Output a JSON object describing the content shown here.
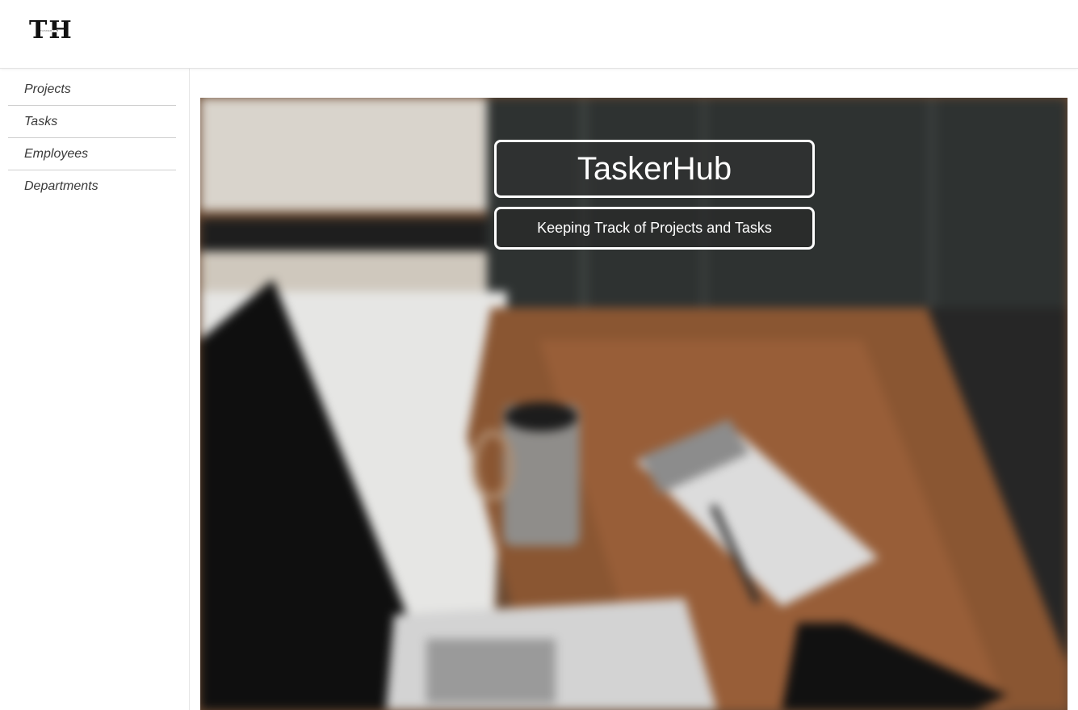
{
  "header": {
    "logo_text": "TH",
    "logo_subtext": "TASKERHUB"
  },
  "sidebar": {
    "items": [
      {
        "label": "Projects"
      },
      {
        "label": "Tasks"
      },
      {
        "label": "Employees"
      },
      {
        "label": "Departments"
      }
    ]
  },
  "hero": {
    "title": "TaskerHub",
    "subtitle": "Keeping Track of Projects and Tasks",
    "image_description_icon": "desk-photo"
  },
  "colors": {
    "hero_text": "#ffffff",
    "nav_text": "#3a3a3a",
    "divider": "#cfcfcf"
  }
}
